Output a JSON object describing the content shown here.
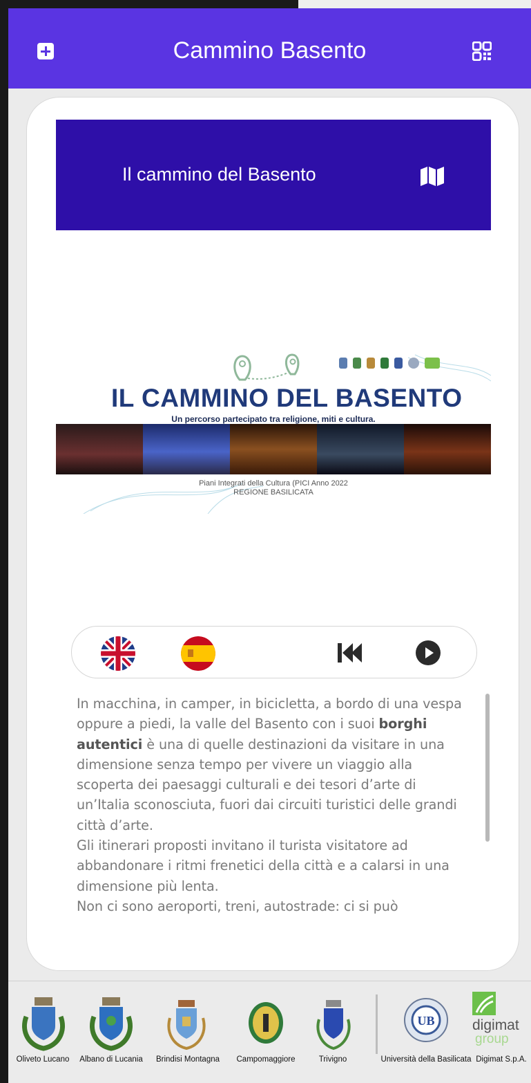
{
  "header": {
    "title": "Cammino Basento",
    "add_icon": "add-box-icon",
    "qr_icon": "qr-code-icon",
    "color": "#5a34e2"
  },
  "card": {
    "banner": {
      "title": "Il cammino del Basento",
      "icon": "map-icon",
      "color": "#2e0fa8"
    },
    "poster": {
      "title": "IL CAMMINO DEL BASENTO",
      "subtitle": "Un percorso partecipato tra religione, miti e cultura.",
      "caption_line1": "Piani Integrati della Cultura (PICI Anno 2022",
      "caption_line2": "REGIONE BASILICATA"
    },
    "controls": {
      "lang_en_icon": "uk-flag-icon",
      "lang_es_icon": "spain-flag-icon",
      "prev_icon": "skip-previous-icon",
      "play_icon": "play-icon"
    },
    "description": {
      "p1_before": "In macchina, in camper, in bicicletta, a bordo di una vespa oppure a piedi, la valle del Basento con i suoi ",
      "p1_bold": "borghi autentici",
      "p1_after": " è una di quelle destinazioni da visitare in una dimensione senza tempo per vivere un viaggio alla scoperta dei paesaggi culturali e dei tesori d’arte di un’Italia sconosciuta, fuori dai circuiti turistici delle grandi città d’arte.",
      "p2": "Gli itinerari proposti invitano il turista visitatore ad abbandonare i ritmi frenetici della città e a calarsi in una dimensione più lenta.",
      "p3": "Non ci sono aeroporti, treni, autostrade: ci si può"
    }
  },
  "footer": {
    "sponsors": [
      {
        "label": "Oliveto Lucano"
      },
      {
        "label": "Albano di Lucania"
      },
      {
        "label": "Brindisi Montagna"
      },
      {
        "label": "Campomaggiore"
      },
      {
        "label": "Trivigno"
      },
      {
        "label": "Università della Basilicata"
      },
      {
        "label": "Digimat S.p.A."
      }
    ],
    "digimat_logo_text": "digimat",
    "digimat_logo_sub": "group"
  }
}
